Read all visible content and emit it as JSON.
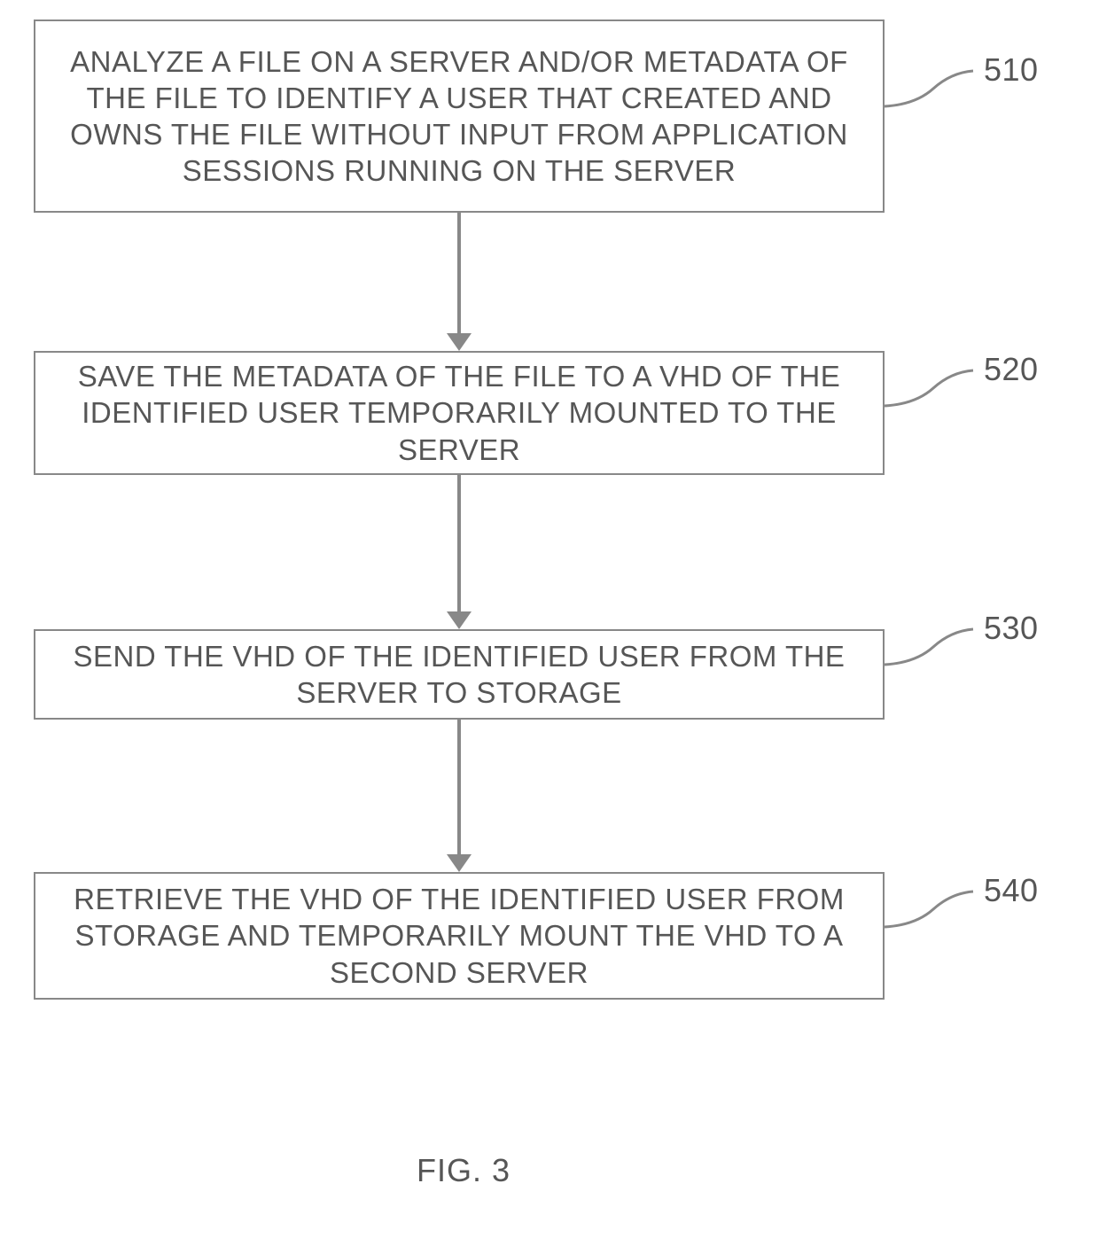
{
  "flowchart": {
    "steps": [
      {
        "id": "510",
        "text": "ANALYZE A FILE ON A SERVER AND/OR METADATA OF THE FILE TO IDENTIFY A USER THAT CREATED AND OWNS THE FILE WITHOUT  INPUT FROM APPLICATION SESSIONS RUNNING ON THE SERVER"
      },
      {
        "id": "520",
        "text": "SAVE THE METADATA OF THE FILE TO A VHD OF THE IDENTIFIED USER TEMPORARILY MOUNTED TO THE SERVER"
      },
      {
        "id": "530",
        "text": "SEND THE VHD OF THE IDENTIFIED USER FROM THE SERVER TO STORAGE"
      },
      {
        "id": "540",
        "text": "RETRIEVE THE VHD OF THE IDENTIFIED USER FROM STORAGE AND TEMPORARILY MOUNT THE VHD TO A SECOND SERVER"
      }
    ],
    "caption": "FIG. 3"
  }
}
